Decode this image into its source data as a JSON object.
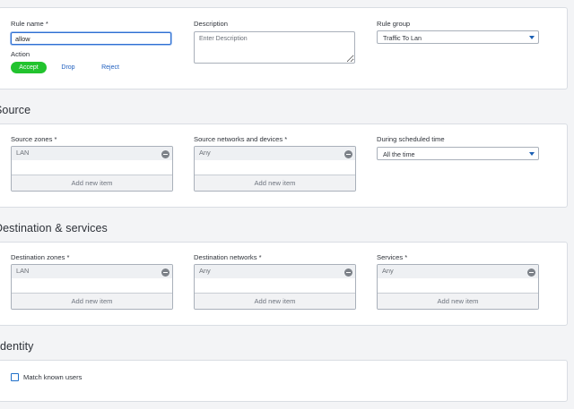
{
  "rule": {
    "name_label": "Rule name *",
    "name_value": "allow",
    "description_label": "Description",
    "description_placeholder": "Enter Description",
    "group_label": "Rule group",
    "group_value": "Traffic To Lan",
    "action_label": "Action",
    "actions": [
      "Accept",
      "Drop",
      "Reject"
    ],
    "active_action": "Accept"
  },
  "source": {
    "title": "Source",
    "zones_label": "Source zones *",
    "zones_item": "LAN",
    "networks_label": "Source networks and devices *",
    "networks_item": "Any",
    "schedule_label": "During scheduled time",
    "schedule_value": "All the time",
    "add_label": "Add new item"
  },
  "destination": {
    "title": "Destination & services",
    "zones_label": "Destination zones *",
    "zones_item": "LAN",
    "networks_label": "Destination networks *",
    "networks_item": "Any",
    "services_label": "Services *",
    "services_item": "Any",
    "add_label": "Add new item"
  },
  "identity": {
    "title": "dentity",
    "match_label": "Match known users"
  },
  "colors": {
    "accept_active": "#22c32e",
    "link": "#1f5fbf",
    "focus_border": "#2f6fd1"
  }
}
